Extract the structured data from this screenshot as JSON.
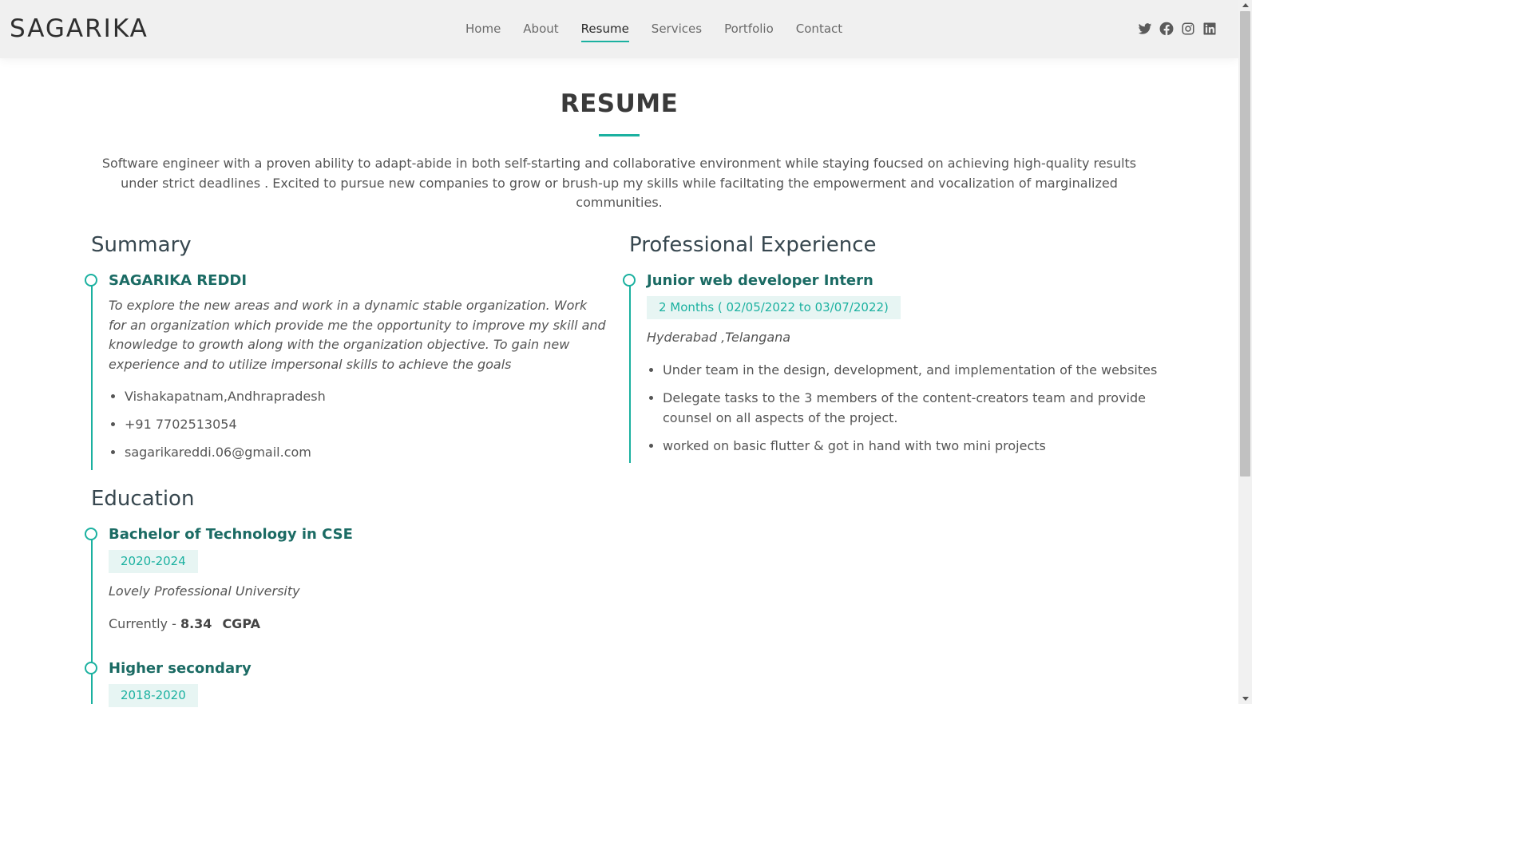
{
  "brand": "SAGARIKA",
  "nav": [
    {
      "label": "Home",
      "active": false
    },
    {
      "label": "About",
      "active": false
    },
    {
      "label": "Resume",
      "active": true
    },
    {
      "label": "Services",
      "active": false
    },
    {
      "label": "Portfolio",
      "active": false
    },
    {
      "label": "Contact",
      "active": false
    }
  ],
  "social": [
    "twitter-icon",
    "facebook-icon",
    "instagram-icon",
    "linkedin-icon"
  ],
  "accent_color": "#1bb1a0",
  "title_color": "#1b6b64",
  "page": {
    "title": "RESUME",
    "intro": "Software engineer with a proven ability to adapt-abide in both self-starting and collaborative environment while staying foucsed on achieving high-quality results under strict deadlines . Excited to pursue new companies to grow or brush-up my skills while faciltating the empowerment and vocalization of marginalized communities."
  },
  "summary": {
    "heading": "Summary",
    "name": "SAGARIKA REDDI",
    "objective": "To explore the new areas and work in a dynamic stable organization. Work for an organization which provide me the opportunity to improve my skill and knowledge to growth along with the organization objective. To gain new experience and to utilize impersonal skills to achieve the goals",
    "contacts": [
      "Vishakapatnam,Andhrapradesh",
      "+91 7702513054",
      "sagarikareddi.06@gmail.com"
    ]
  },
  "education": {
    "heading": "Education",
    "items": [
      {
        "title": "Bachelor of Technology in CSE",
        "period": "2020-2024",
        "institution": "Lovely Professional University",
        "score_prefix": "Currently - ",
        "score": "8.34",
        "score_unit": "CGPA"
      },
      {
        "title": "Higher secondary",
        "period": "2018-2020"
      }
    ]
  },
  "experience": {
    "heading": "Professional Experience",
    "items": [
      {
        "title": "Junior web developer Intern",
        "period": "2 Months ( 02/05/2022 to 03/07/2022)",
        "location": "Hyderabad ,Telangana",
        "bullets": [
          "Under team in the design, development, and implementation of the websites",
          "Delegate tasks to the 3 members of the content-creators team and provide counsel on all aspects of the project.",
          "worked on basic flutter & got in hand with two mini projects"
        ]
      }
    ]
  }
}
